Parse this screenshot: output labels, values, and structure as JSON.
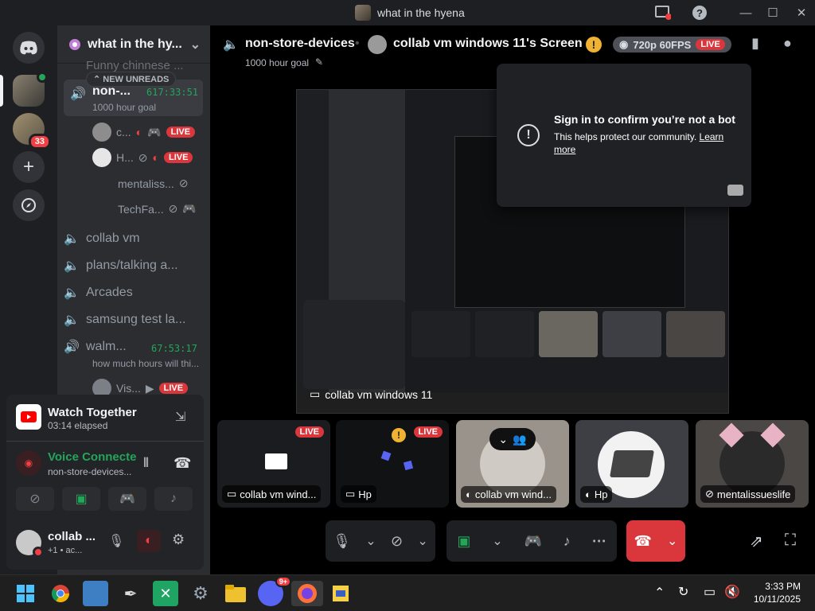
{
  "window": {
    "title": "what in the hyena"
  },
  "server": {
    "name": "what in the hy...",
    "server_badge": "33"
  },
  "channels": {
    "partial_top": "Funny chinnese ...",
    "new_unreads": "NEW UNREADS",
    "active": {
      "name": "non-...",
      "timer": "617:33:51",
      "topic": "1000 hour goal"
    },
    "voice_users": [
      {
        "name": "c...",
        "live": "LIVE"
      },
      {
        "name": "H...",
        "live": "LIVE"
      },
      {
        "name": "mentaliss..."
      },
      {
        "name": "TechFa..."
      }
    ],
    "list": [
      {
        "name": "collab vm"
      },
      {
        "name": "plans/talking a..."
      },
      {
        "name": "Arcades"
      },
      {
        "name": "samsung test la..."
      },
      {
        "name": "walm...",
        "timer": "67:53:17",
        "topic": "how much hours will thi..."
      }
    ],
    "vis_user": {
      "name": "Vis...",
      "live": "LIVE"
    }
  },
  "activity": {
    "title": "Watch Together",
    "elapsed": "03:14 elapsed"
  },
  "voice": {
    "status": "Voice Connected",
    "channel": "non-store-devices..."
  },
  "user": {
    "name": "collab ...",
    "status": "+1 • ac..."
  },
  "header": {
    "channel": "non-store-devices",
    "topic": "1000 hour goal",
    "stream_title": "collab vm windows 11's Screen",
    "quality": "720p 60FPS",
    "live": "LIVE"
  },
  "popup": {
    "title": "Sign in to confirm you’re not a bot",
    "body": "This helps protect our community.",
    "link": "Learn more"
  },
  "share_caption": "collab vm windows 11",
  "tiles": [
    {
      "label": "collab vm wind...",
      "live": "LIVE"
    },
    {
      "label": "Hp",
      "live": "LIVE"
    },
    {
      "label": "collab vm wind..."
    },
    {
      "label": "Hp"
    },
    {
      "label": "mentalissueslife"
    }
  ],
  "taskbar": {
    "time": "3:33 PM",
    "date": "10/11/2025",
    "discord_badge": "9+"
  },
  "colors": {
    "accent": "#5865f2",
    "live": "#da373c",
    "green": "#23a55a"
  }
}
